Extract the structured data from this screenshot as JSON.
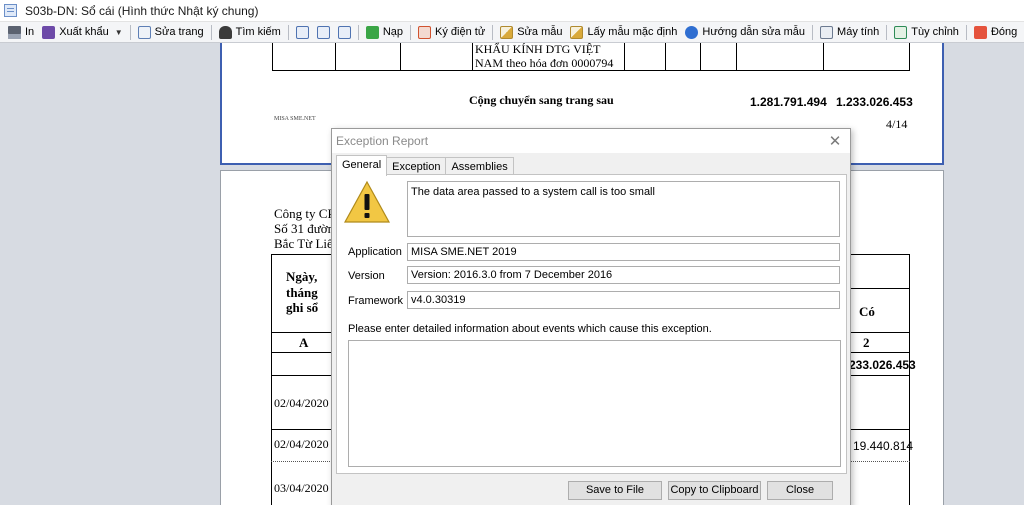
{
  "window": {
    "title": "S03b-DN: Sổ cái (Hình thức Nhật ký chung)"
  },
  "toolbar": {
    "items": [
      {
        "label": "In",
        "icon": "printer-icon"
      },
      {
        "label": "Xuất khẩu",
        "icon": "export-icon"
      },
      {
        "label": "Sửa trang",
        "icon": "edit-page-icon"
      },
      {
        "label": "Tìm kiếm",
        "icon": "binoculars-icon"
      },
      {
        "label": "Nạp",
        "icon": "reload-icon"
      },
      {
        "label": "Ký điện tử",
        "icon": "digital-sign-icon"
      },
      {
        "label": "Sửa mẫu",
        "icon": "edit-template-icon"
      },
      {
        "label": "Lấy mẫu mặc định",
        "icon": "default-template-icon"
      },
      {
        "label": "Hướng dẫn sửa mẫu",
        "icon": "help-icon"
      },
      {
        "label": "Máy tính",
        "icon": "calculator-icon"
      },
      {
        "label": "Tùy chỉnh",
        "icon": "customize-icon"
      },
      {
        "label": "Đóng",
        "icon": "close-power-icon"
      }
    ]
  },
  "report": {
    "page1": {
      "desc_line1": "KHẨU KÍNH DTG VIỆT",
      "desc_line2": "NAM theo hóa đơn 0000794",
      "carry_label": "Cộng chuyển sang trang sau",
      "carry_debit": "1.281.791.494",
      "carry_credit": "1.233.026.453",
      "footer_brand": "MISA SME.NET",
      "page_number": "4/14"
    },
    "page2": {
      "company_1": "Công ty CP",
      "company_2": "Số 31 đườn",
      "company_3": "Bắc Từ Liê",
      "col_date": "Ngày, tháng ghi sổ",
      "col_date_l1": "Ngày,",
      "col_date_l2": "tháng",
      "col_date_l3": "ghi sổ",
      "col_credit": "Có",
      "row_code_a": "A",
      "row_code_2": "2",
      "opening_credit": "233.026.453",
      "dates": [
        "02/04/2020",
        "02/04/2020",
        "03/04/2020"
      ],
      "row2_credit": "19.440.814"
    }
  },
  "dialog": {
    "title": "Exception Report",
    "tabs": [
      "General",
      "Exception",
      "Assemblies"
    ],
    "message": "The data area passed to a system call is too small",
    "application_label": "Application",
    "application_value": "MISA SME.NET 2019",
    "version_label": "Version",
    "version_value": "Version: 2016.3.0 from 7 December 2016",
    "framework_label": "Framework",
    "framework_value": "v4.0.30319",
    "details_prompt": "Please enter detailed information about events which cause this exception.",
    "details_value": "",
    "buttons": {
      "save": "Save to File",
      "copy": "Copy to Clipboard",
      "close": "Close"
    }
  },
  "colors": {
    "page_border": "#3d5fb1",
    "warning": "#f2c744"
  }
}
